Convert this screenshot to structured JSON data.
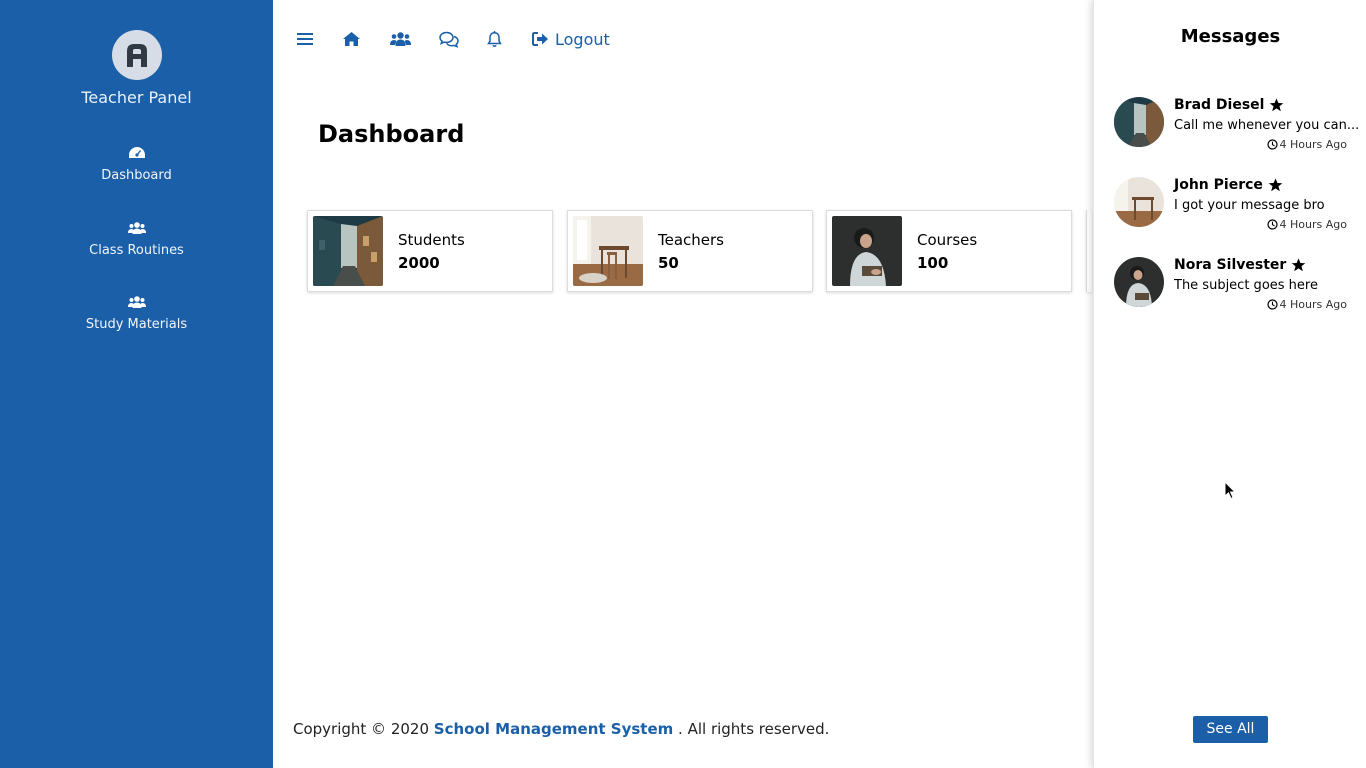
{
  "sidebar": {
    "logo_icon": "letter-a-logo",
    "title": "Teacher Panel",
    "items": [
      {
        "label": "Dashboard",
        "icon": "gauge-icon"
      },
      {
        "label": "Class Routines",
        "icon": "users-icon"
      },
      {
        "label": "Study Materials",
        "icon": "users-icon"
      }
    ]
  },
  "topbar": {
    "icons": [
      "menu-icon",
      "home-icon",
      "users-icon",
      "comments-icon",
      "bell-icon"
    ],
    "logout_label": "Logout"
  },
  "main": {
    "page_title": "Dashboard",
    "cards": [
      {
        "label": "Students",
        "value": "2000",
        "image": "street-photo"
      },
      {
        "label": "Teachers",
        "value": "50",
        "image": "room-photo"
      },
      {
        "label": "Courses",
        "value": "100",
        "image": "woman-reading-photo"
      }
    ]
  },
  "footer": {
    "prefix": "Copyright © 2020",
    "brand": "School Management System",
    "suffix": ". All rights reserved."
  },
  "messages": {
    "title": "Messages",
    "items": [
      {
        "name": "Brad Diesel",
        "text": "Call me whenever you can...",
        "time": "4 Hours Ago"
      },
      {
        "name": "John Pierce",
        "text": "I got your message bro",
        "time": "4 Hours Ago"
      },
      {
        "name": "Nora Silvester",
        "text": "The subject goes here",
        "time": "4 Hours Ago"
      }
    ],
    "see_all_label": "See All"
  },
  "colors": {
    "primary": "#1a5fa8",
    "sidebar_bg": "#1a5fa8"
  }
}
